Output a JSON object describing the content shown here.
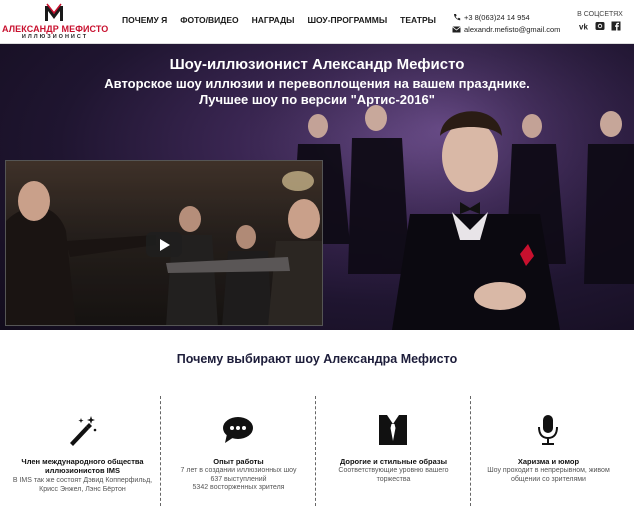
{
  "header": {
    "logo": {
      "name": "АЛЕКСАНДР МЕФИСТО",
      "subtitle": "ИЛЛЮЗИОНИСТ"
    },
    "nav": [
      "ПОЧЕМУ Я",
      "ФОТО/ВИДЕО",
      "НАГРАДЫ",
      "ШОУ-ПРОГРАММЫ",
      "ТЕАТРЫ"
    ],
    "phone": "+3 8(063)24 14 954",
    "email": "alexandr.mefisto@gmail.com",
    "social_label": "В СОЦСЕТЯХ",
    "social_icons": [
      "vk-icon",
      "instagram-icon",
      "facebook-icon"
    ]
  },
  "hero": {
    "line1": "Шоу-иллюзионист Александр Мефисто",
    "line2": "Авторское шоу иллюзии и перевоплощения на вашем празднике.",
    "line3": "Лучшее шоу по версии \"Артис-2016\""
  },
  "section": {
    "title": "Почему выбирают шоу Александра Мефисто",
    "features": [
      {
        "icon": "magic-wand-icon",
        "title": "Член международного общества иллюзионистов IMS",
        "lines": [
          "В IMS так же состоят Дэвид Копперфильд,",
          "Крисс Энжел, Лэнс Бёртон"
        ]
      },
      {
        "icon": "speech-bubble-icon",
        "title": "Опыт работы",
        "lines": [
          "7 лет в создании иллюзионных шоу",
          "637 выступлений",
          "5342 восторженных зрителя"
        ]
      },
      {
        "icon": "tuxedo-tie-icon",
        "title": "Дорогие и стильные образы",
        "lines": [
          "Соответствующие уровню вашего",
          "торжества"
        ]
      },
      {
        "icon": "microphone-icon",
        "title": "Харизма и юмор",
        "lines": [
          "Шоу проходит в непрерывном, живом",
          "общении со зрителями"
        ]
      }
    ]
  },
  "colors": {
    "brand_red": "#c8102e",
    "accent_purple": "#3d2a5c",
    "title_navy": "#1d1d3a"
  }
}
